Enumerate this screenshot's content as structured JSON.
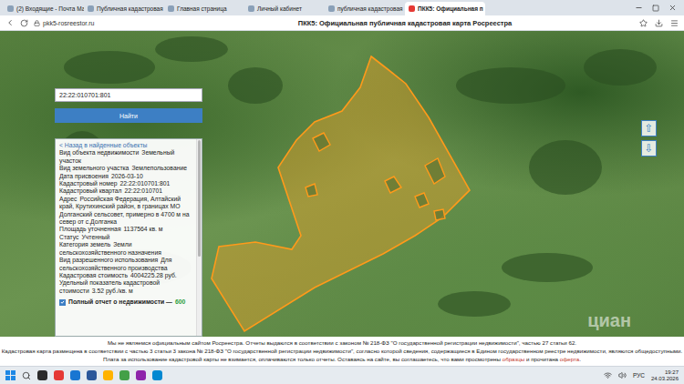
{
  "browser": {
    "tabs": [
      {
        "label": "(2) Входящие - Почта Ма",
        "selected": false
      },
      {
        "label": "Публичная кадастровая",
        "selected": false
      },
      {
        "label": "Главная страница",
        "selected": false
      },
      {
        "label": "Личный кабинет",
        "selected": false
      },
      {
        "label": "публичная кадастровая",
        "selected": false
      },
      {
        "label": "ПКК5: Официальная п",
        "selected": true
      }
    ],
    "url": "pkk5-rosreestor.ru",
    "page_title": "ПКК5: Официальная публичная кадастровая карта Росреестра"
  },
  "search": {
    "value": "22:22:010701:801",
    "button": "Найти"
  },
  "info_panel": {
    "back_link": "< Назад в найденные объекты",
    "rows": [
      {
        "label": "Вид объекта недвижимости",
        "value": "Земельный участок"
      },
      {
        "label": "Вид земельного участка",
        "value": "Землепользование"
      },
      {
        "label": "Дата присвоения",
        "value": "2026-03-10"
      },
      {
        "label": "Кадастровый номер",
        "value": "22:22:010701:801"
      },
      {
        "label": "Кадастровый квартал",
        "value": "22:22:010701"
      },
      {
        "label": "Адрес",
        "value": "Российская Федерация, Алтайский край, Крутихинский район, в границах МО Долганский сельсовет, примерно в 4700 м на север от с.Долганка"
      },
      {
        "label": "Площадь уточненная",
        "value": "1137564 кв. м"
      },
      {
        "label": "Статус",
        "value": "Учтенный"
      },
      {
        "label": "Категория земель",
        "value": "Земли сельскохозяйственного назначения"
      },
      {
        "label": "Вид разрешенного использования",
        "value": "Для сельскохозяйственного производства"
      },
      {
        "label": "Кадастровая стоимость",
        "value": "4004225.28 руб."
      },
      {
        "label": "Удельный показатель кадастровой стоимости",
        "value": "3.52 руб./кв. м"
      }
    ],
    "report": {
      "checked": true,
      "label": "Полный отчет о недвижимости — ",
      "price": "600"
    }
  },
  "map": {
    "zoom_in": "⇧",
    "zoom_out": "⇩",
    "watermark": "циан"
  },
  "footer": {
    "lines": [
      [
        {
          "text": "Мы не являемся официальным сайтом Росреестра. Отчеты выдаются в соответствии с законом № 218-ФЗ \"О государственной регистрации недвижимости\", частью 27 статьи 62.",
          "link": false
        }
      ],
      [
        {
          "text": "Кадастровая карта размещена в соответствии с частью 3 статьи 3 закона № 218-ФЗ \"О государственной регистрации недвижимости\", согласно которой сведения, содержащиеся в Едином государственном реестре недвижимости, являются общедоступными.",
          "link": false
        }
      ],
      [
        {
          "text": "Плата за использование кадастровой карты не взимается, оплачиваются только отчеты. Оставаясь на сайте, вы соглашаетесь, что вами просмотрены ",
          "link": false
        },
        {
          "text": "образцы",
          "link": true
        },
        {
          "text": " и прочитана ",
          "link": false
        },
        {
          "text": "оферта",
          "link": true
        },
        {
          "text": ".",
          "link": false
        }
      ]
    ]
  },
  "taskbar": {
    "lang": "РУС",
    "time": "19:27",
    "date": "24.03.2026"
  }
}
